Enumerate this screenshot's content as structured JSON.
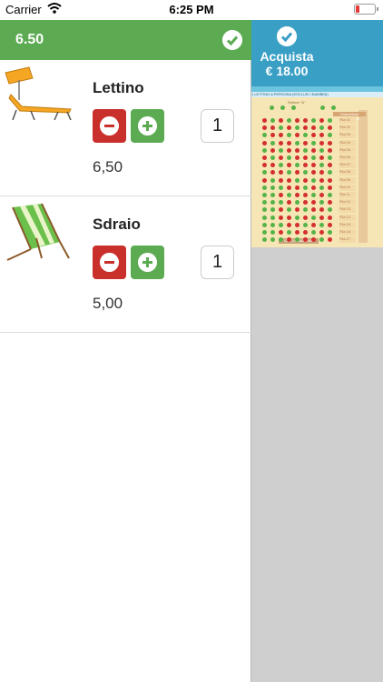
{
  "status_bar": {
    "carrier": "Carrier",
    "time": "6:25 PM"
  },
  "header": {
    "total": "6.50"
  },
  "items": [
    {
      "name": "Lettino",
      "quantity": "1",
      "price": "6,50"
    },
    {
      "name": "Sdraio",
      "quantity": "1",
      "price": "5,00"
    }
  ],
  "purchase": {
    "label": "Acquista",
    "amount": "€ 18.00"
  },
  "map": {
    "banner": "1 LETTINO A PERSONA (ESCLUSI I BAMBINI)",
    "sector": "Settore \"A\"",
    "legend": "Ombrellone COLORATO",
    "bottom": "GIOCHI BAMBINI",
    "rows": [
      "Fila 01",
      "Fila 02",
      "Fila 03",
      "Fila 04",
      "Fila 05",
      "Fila 06",
      "Fila 07",
      "Fila 08",
      "Fila 09",
      "Fila 10",
      "Fila 11",
      "Fila 12",
      "Fila 13",
      "Fila 14",
      "Fila 15",
      "Fila 16",
      "Fila 17"
    ],
    "colors": {
      "free": "#56b348",
      "taken": "#d32f2f"
    }
  },
  "colors": {
    "accent_green": "#5cab52",
    "accent_red": "#c9302c",
    "accent_blue": "#3a9fc5"
  }
}
